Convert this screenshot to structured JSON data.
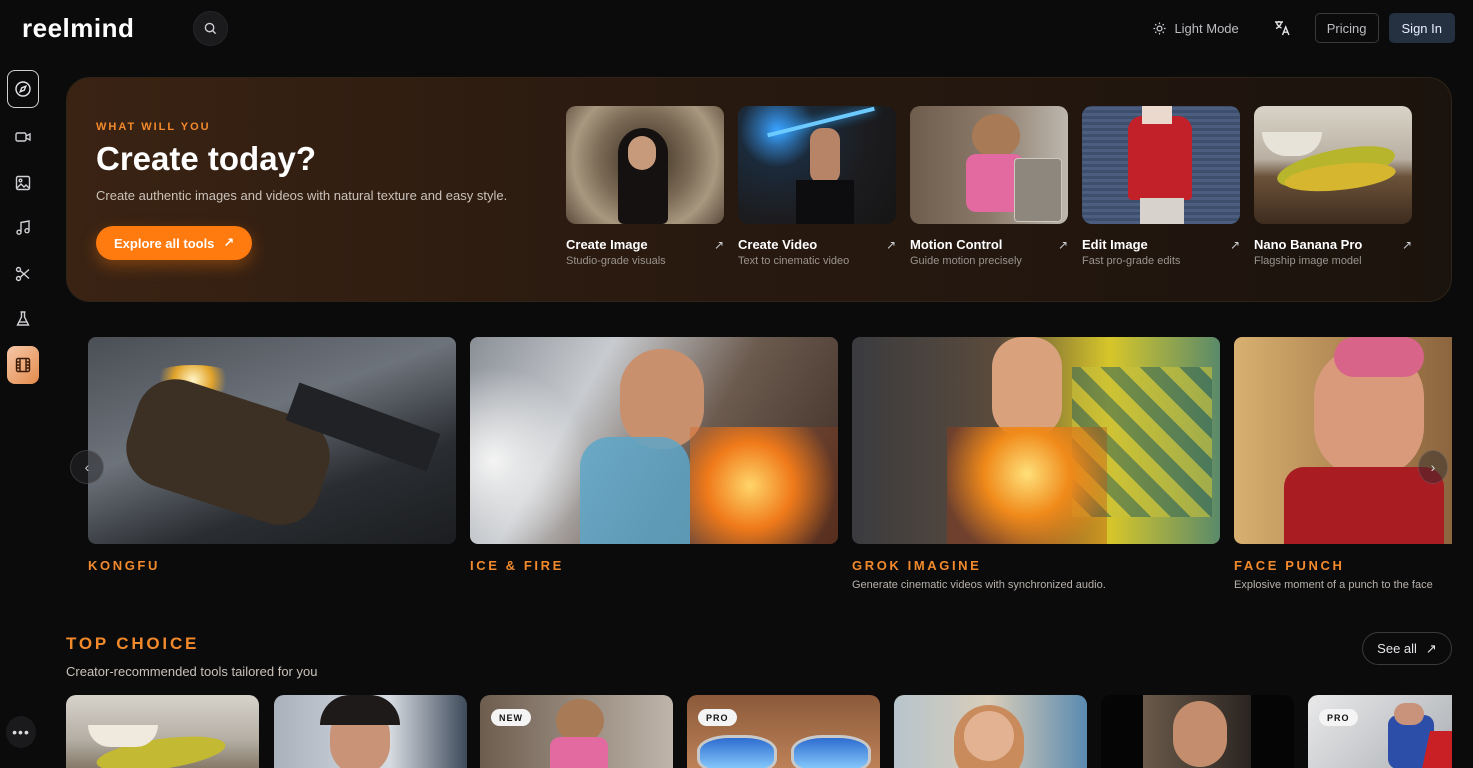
{
  "header": {
    "logo": "reelmind",
    "light_mode_label": "Light Mode",
    "pricing_label": "Pricing",
    "sign_in_label": "Sign In"
  },
  "sidebar": {
    "items": [
      {
        "icon": "compass-icon",
        "active": true
      },
      {
        "icon": "video-camera-icon"
      },
      {
        "icon": "image-icon"
      },
      {
        "icon": "music-note-icon"
      },
      {
        "icon": "scissors-icon"
      },
      {
        "icon": "flask-icon"
      },
      {
        "icon": "film-strip-icon",
        "highlight": true
      }
    ],
    "more_label": "•••"
  },
  "hero": {
    "kicker": "WHAT WILL YOU",
    "title": "Create today?",
    "subtitle": "Create authentic images and videos with natural texture and easy style.",
    "cta_label": "Explore all tools",
    "tools": [
      {
        "name": "Create Image",
        "desc": "Studio-grade visuals"
      },
      {
        "name": "Create Video",
        "desc": "Text to cinematic video"
      },
      {
        "name": "Motion Control",
        "desc": "Guide motion precisely"
      },
      {
        "name": "Edit Image",
        "desc": "Fast pro-grade edits"
      },
      {
        "name": "Nano Banana Pro",
        "desc": "Flagship image model"
      }
    ]
  },
  "carousel": {
    "slides": [
      {
        "title": "KONGFU",
        "desc": ""
      },
      {
        "title": "ICE & FIRE",
        "desc": ""
      },
      {
        "title": "GROK IMAGINE",
        "desc": "Generate cinematic videos with synchronized audio."
      },
      {
        "title": "FACE PUNCH",
        "desc": "Explosive moment of a punch to the face"
      }
    ]
  },
  "top_choice": {
    "title": "TOP CHOICE",
    "subtitle": "Creator-recommended tools tailored for you",
    "see_all_label": "See all",
    "cards": [
      {
        "badge": ""
      },
      {
        "badge": ""
      },
      {
        "badge": "NEW"
      },
      {
        "badge": "PRO"
      },
      {
        "badge": ""
      },
      {
        "badge": ""
      },
      {
        "badge": "PRO"
      }
    ]
  },
  "colors": {
    "accent": "#f28a2c",
    "cta": "#ff7a0f",
    "sign_in_bg": "#253041"
  }
}
